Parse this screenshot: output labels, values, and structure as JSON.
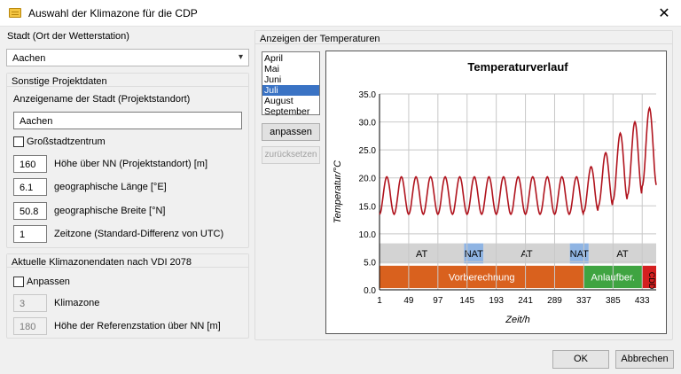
{
  "window": {
    "title": "Auswahl der Klimazone für die CDP",
    "close_glyph": "✕"
  },
  "left": {
    "city_label": "Stadt (Ort der Wetterstation)",
    "city_value": "Aachen",
    "project": {
      "title": "Sonstige Projektdaten",
      "display_name_label": "Anzeigename der Stadt (Projektstandort)",
      "display_name_value": "Aachen",
      "metro_label": "Großstadtzentrum",
      "fields": [
        {
          "value": "160",
          "label": "Höhe über NN (Projektstandort) [m]"
        },
        {
          "value": "6.1",
          "label": "geographische Länge [°E]"
        },
        {
          "value": "50.8",
          "label": "geographische Breite [°N]"
        },
        {
          "value": "1",
          "label": "Zeitzone (Standard-Differenz von UTC)"
        }
      ]
    },
    "climate": {
      "title": "Aktuelle Klimazonendaten nach VDI 2078",
      "adjust_label": "Anpassen",
      "fields": [
        {
          "value": "3",
          "label": "Klimazone"
        },
        {
          "value": "180",
          "label": "Höhe der Referenzstation über NN [m]"
        }
      ]
    }
  },
  "right": {
    "title": "Anzeigen der Temperaturen",
    "months": [
      "April",
      "Mai",
      "Juni",
      "Juli",
      "August",
      "September"
    ],
    "selected_month": "Juli",
    "adjust_button": "anpassen",
    "reset_button": "zurücksetzen"
  },
  "footer": {
    "ok": "OK",
    "cancel": "Abbrechen"
  },
  "colors": {
    "line": "#b0141e",
    "grey_band": "#d3d3d3",
    "nat": "#8fb4e3",
    "orange": "#d9611e",
    "green": "#3fa441",
    "red": "#d42020"
  },
  "chart_data": {
    "type": "line",
    "title": "Temperaturverlauf",
    "xlabel": "Zeit/h",
    "ylabel": "Temperatur/°C",
    "xlim": [
      1,
      456
    ],
    "ylim": [
      0,
      35
    ],
    "x_ticks": [
      1,
      49,
      97,
      145,
      193,
      241,
      289,
      337,
      385,
      433
    ],
    "y_ticks": [
      "0.0",
      "5.0",
      "10.0",
      "15.0",
      "20.0",
      "25.0",
      "30.0",
      "35.0"
    ],
    "grid": true,
    "series": [
      {
        "period_h": 24,
        "daily": [
          {
            "day": 1,
            "min": 13.5,
            "max": 20.2
          },
          {
            "day": 2,
            "min": 13.5,
            "max": 20.2
          },
          {
            "day": 3,
            "min": 13.5,
            "max": 20.2
          },
          {
            "day": 4,
            "min": 13.5,
            "max": 20.2
          },
          {
            "day": 5,
            "min": 13.5,
            "max": 20.2
          },
          {
            "day": 6,
            "min": 13.5,
            "max": 20.2
          },
          {
            "day": 7,
            "min": 13.5,
            "max": 20.2
          },
          {
            "day": 8,
            "min": 13.5,
            "max": 20.2
          },
          {
            "day": 9,
            "min": 13.5,
            "max": 20.2
          },
          {
            "day": 10,
            "min": 13.5,
            "max": 20.2
          },
          {
            "day": 11,
            "min": 13.5,
            "max": 20.2
          },
          {
            "day": 12,
            "min": 13.5,
            "max": 20.2
          },
          {
            "day": 13,
            "min": 13.5,
            "max": 20.2
          },
          {
            "day": 14,
            "min": 13.5,
            "max": 20.2
          },
          {
            "day": 15,
            "min": 14.0,
            "max": 22.0
          },
          {
            "day": 16,
            "min": 15.0,
            "max": 24.5
          },
          {
            "day": 17,
            "min": 16.0,
            "max": 28.0
          },
          {
            "day": 18,
            "min": 17.0,
            "max": 30.0
          },
          {
            "day": 19,
            "min": 18.5,
            "max": 32.5
          }
        ]
      }
    ],
    "bands": [
      {
        "label": "AT",
        "from": 1,
        "to": 140,
        "kind": "grey_band"
      },
      {
        "label": "NAT",
        "from": 140,
        "to": 172,
        "kind": "nat"
      },
      {
        "label": "AT",
        "from": 172,
        "to": 314,
        "kind": "grey_band"
      },
      {
        "label": "NAT",
        "from": 314,
        "to": 345,
        "kind": "nat"
      },
      {
        "label": "AT",
        "from": 345,
        "to": 456,
        "kind": "grey_band"
      }
    ],
    "phases": [
      {
        "label": "Vorberechnung",
        "from": 1,
        "to": 337,
        "kind": "orange"
      },
      {
        "label": "Anlaufber.",
        "from": 337,
        "to": 433,
        "kind": "green"
      },
      {
        "label": "CDD",
        "from": 433,
        "to": 456,
        "kind": "red"
      }
    ]
  }
}
